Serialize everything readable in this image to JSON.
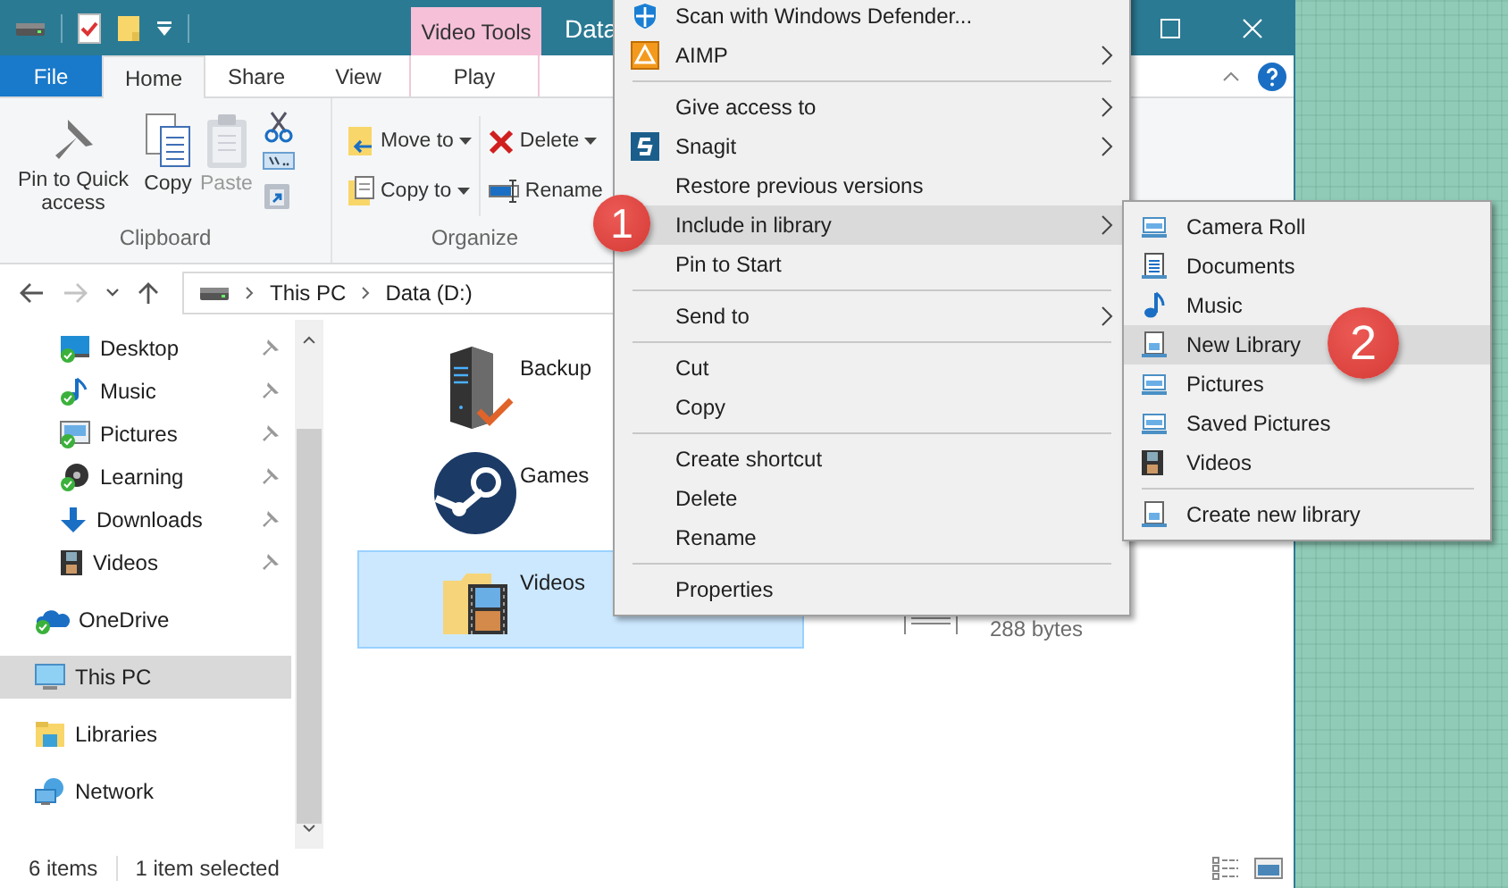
{
  "window": {
    "title": "Data",
    "contextual_tab": "Video Tools"
  },
  "ribbon_tabs": [
    {
      "label": "File",
      "selected": false,
      "kind": "file"
    },
    {
      "label": "Home",
      "selected": true,
      "kind": "tab"
    },
    {
      "label": "Share",
      "selected": false,
      "kind": "tab"
    },
    {
      "label": "View",
      "selected": false,
      "kind": "tab"
    },
    {
      "label": "Play",
      "selected": false,
      "kind": "contextual"
    }
  ],
  "ribbon_groups": [
    {
      "label": "Clipboard",
      "commands": [
        {
          "label": "Pin to Quick access",
          "kind": "large",
          "disabled": false
        },
        {
          "label": "Copy",
          "kind": "large",
          "disabled": false
        },
        {
          "label": "Paste",
          "kind": "large",
          "disabled": true
        },
        {
          "kind": "icons"
        }
      ]
    },
    {
      "label": "Organize",
      "commands": [
        {
          "label": "Move to",
          "kind": "small",
          "dropdown": true
        },
        {
          "label": "Copy to",
          "kind": "small",
          "dropdown": true
        },
        {
          "label": "Delete",
          "kind": "small",
          "dropdown": true
        },
        {
          "label": "Rename",
          "kind": "small",
          "dropdown": false
        }
      ]
    }
  ],
  "nav_buttons": [
    {
      "kind": "back",
      "disabled": false
    },
    {
      "kind": "forward",
      "disabled": true
    },
    {
      "kind": "recent",
      "disabled": false
    },
    {
      "kind": "up",
      "disabled": false
    }
  ],
  "address": {
    "path": [
      "This PC",
      "Data (D:)"
    ]
  },
  "quick_access": [
    {
      "label": "Desktop",
      "pinned": true
    },
    {
      "label": "Music",
      "pinned": true
    },
    {
      "label": "Pictures",
      "pinned": true
    },
    {
      "label": "Learning",
      "pinned": true
    },
    {
      "label": "Downloads",
      "pinned": true
    },
    {
      "label": "Videos",
      "pinned": true
    }
  ],
  "nav_items": [
    {
      "label": "OneDrive",
      "selected": false
    },
    {
      "label": "This PC",
      "selected": true
    },
    {
      "label": "Libraries",
      "selected": false
    },
    {
      "label": "Network",
      "selected": false
    }
  ],
  "files": [
    {
      "name": "Backup",
      "selected": false
    },
    {
      "name": "Games",
      "selected": false
    },
    {
      "name": "Videos",
      "selected": true
    }
  ],
  "partial_file": {
    "detail": "288 bytes"
  },
  "status_bar": {
    "item_count": "6 items",
    "selection": "1 item selected"
  },
  "context_menu": {
    "sections": [
      [
        {
          "label": "Scan with Windows Defender...",
          "submenu": false,
          "selected": false
        },
        {
          "label": "AIMP",
          "submenu": true,
          "selected": false
        }
      ],
      [
        {
          "label": "Give access to",
          "submenu": true,
          "selected": false
        },
        {
          "label": "Snagit",
          "submenu": true,
          "selected": false
        },
        {
          "label": "Restore previous versions",
          "submenu": false,
          "selected": false
        },
        {
          "label": "Include in library",
          "submenu": true,
          "selected": true
        },
        {
          "label": "Pin to Start",
          "submenu": false,
          "selected": false
        }
      ],
      [
        {
          "label": "Send to",
          "submenu": true,
          "selected": false
        }
      ],
      [
        {
          "label": "Cut",
          "submenu": false,
          "selected": false
        },
        {
          "label": "Copy",
          "submenu": false,
          "selected": false
        }
      ],
      [
        {
          "label": "Create shortcut",
          "submenu": false,
          "selected": false
        },
        {
          "label": "Delete",
          "submenu": false,
          "selected": false
        },
        {
          "label": "Rename",
          "submenu": false,
          "selected": false
        }
      ],
      [
        {
          "label": "Properties",
          "submenu": false,
          "selected": false
        }
      ]
    ]
  },
  "library_submenu": {
    "sections": [
      [
        {
          "label": "Camera Roll",
          "selected": false
        },
        {
          "label": "Documents",
          "selected": false
        },
        {
          "label": "Music",
          "selected": false
        },
        {
          "label": "New Library",
          "selected": true
        },
        {
          "label": "Pictures",
          "selected": false
        },
        {
          "label": "Saved Pictures",
          "selected": false
        },
        {
          "label": "Videos",
          "selected": false
        }
      ],
      [
        {
          "label": "Create new library",
          "selected": false
        }
      ]
    ]
  },
  "callouts": [
    {
      "number": "1"
    },
    {
      "number": "2"
    }
  ]
}
